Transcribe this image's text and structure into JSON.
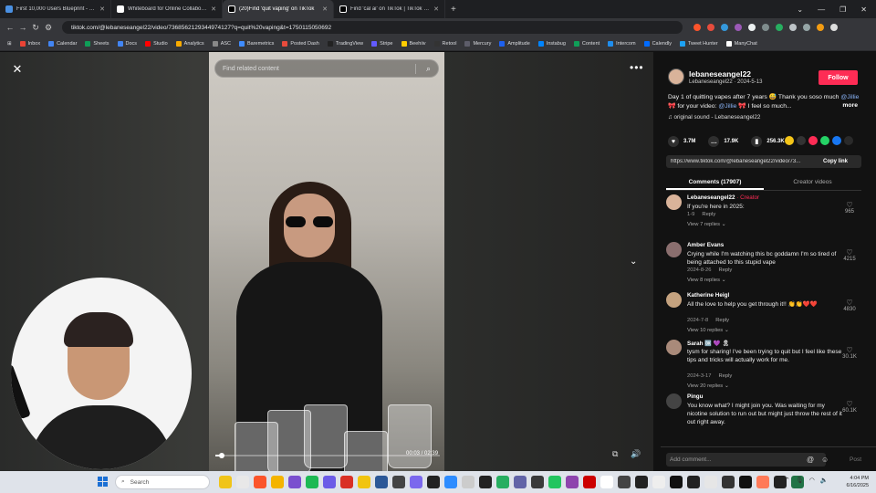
{
  "browser": {
    "tabs": [
      {
        "label": "First 10,000 Users Blueprint - Google",
        "color": "#4a90e2",
        "active": false
      },
      {
        "label": "Whiteboard for Online Collaboration",
        "color": "#ffffff",
        "active": false
      },
      {
        "label": "(20)Find 'quit vaping' on TikTok",
        "color": "#111111",
        "active": true
      },
      {
        "label": "Find 'cal ai' on TikTok | TikTok Search",
        "color": "#111111",
        "active": false
      }
    ],
    "url": "tiktok.com/@lebaneseangel22/video/7368562129344974127?q=quit%20vaping&t=1750115050692",
    "bookmarks": [
      {
        "label": "Inbox",
        "color": "#ea4335"
      },
      {
        "label": "Calendar",
        "color": "#4285f4"
      },
      {
        "label": "Sheets",
        "color": "#0f9d58"
      },
      {
        "label": "Docs",
        "color": "#4285f4"
      },
      {
        "label": "Studio",
        "color": "#ff0000"
      },
      {
        "label": "Analytics",
        "color": "#f9ab00"
      },
      {
        "label": "ASC",
        "color": "#888888"
      },
      {
        "label": "Baremetrics",
        "color": "#3f8cff"
      },
      {
        "label": "Posted Dash",
        "color": "#e84b3c"
      },
      {
        "label": "TradingView",
        "color": "#222222"
      },
      {
        "label": "Stripe",
        "color": "#635bff"
      },
      {
        "label": "Beehiiv",
        "color": "#ffcc00"
      },
      {
        "label": "Retool",
        "color": "#333333"
      },
      {
        "label": "Mercury",
        "color": "#5d5d6a"
      },
      {
        "label": "Amplitude",
        "color": "#1e61f0"
      },
      {
        "label": "Instabug",
        "color": "#0084ff"
      },
      {
        "label": "Content",
        "color": "#0f9d58"
      },
      {
        "label": "Intercom",
        "color": "#1f8ded"
      },
      {
        "label": "Calendly",
        "color": "#006bff"
      },
      {
        "label": "Tweet Hunter",
        "color": "#1da1f2"
      },
      {
        "label": "ManyChat",
        "color": "#ffffff"
      }
    ]
  },
  "video": {
    "search_placeholder": "Find related content",
    "time": "00:03 / 02:39",
    "progress": 0.03
  },
  "post": {
    "author": "lebaneseangel22",
    "author_sub": "Lebaneseangel22 · 2024-5-13",
    "follow_label": "Follow",
    "caption_part1": "Day 1 of quitting vapes after 7 years 😅 Thank you soso much ",
    "caption_mention1": "@Jillie",
    "caption_part2": " 🎀 for your video: ",
    "caption_mention2": "@Jillie",
    "caption_part3": " 🎀 I feel so much...",
    "caption_more": "more",
    "sound": "♫  original sound - Lebaneseangel22",
    "likes": "3.7M",
    "comments": "17.9K",
    "saves": "256.3K",
    "link": "https://www.tiktok.com/@lebaneseangel22/video/73...",
    "copy_link": "Copy link",
    "tab_comments": "Comments (17907)",
    "tab_creator": "Creator videos",
    "share_colors": [
      "#f5c518",
      "#333333",
      "#fe2c55",
      "#25d366",
      "#1877f2",
      "#2a2a2a"
    ]
  },
  "comments": [
    {
      "user": "Lebaneseangel22",
      "creator": "· Creator",
      "text": "If you're here in 2025:",
      "date": "1-9",
      "reply": "Reply",
      "replies": "View 7 replies ⌄",
      "likes": "965",
      "avatar": "#d9b39a"
    },
    {
      "user": "Amber Evans",
      "creator": "",
      "text": "Crying while I'm watching this bc goddamn I'm so tired of being attached to this stupid vape",
      "date": "2024-8-26",
      "reply": "Reply",
      "replies": "View 8 replies ⌄",
      "likes": "4215",
      "avatar": "#8a6e6e"
    },
    {
      "user": "Katherine Heigl",
      "creator": "",
      "text": "All the love to help you get through it!! 👏👏❤️❤️",
      "date": "2024-7-8",
      "reply": "Reply",
      "replies": "View 10 replies ⌄",
      "likes": "4830",
      "avatar": "#c4a27f"
    },
    {
      "user": "Sarah 🆗 💜 🎗",
      "creator": "",
      "text": "tysm for sharing! I've been trying to quit but I feel like these tips and tricks will actually work for me.",
      "date": "2024-3-17",
      "reply": "Reply",
      "replies": "View 20 replies ⌄",
      "likes": "30.1K",
      "avatar": "#a98a7a"
    },
    {
      "user": "Pingu",
      "creator": "",
      "text": "You know what? I might join you. Was waiting for my nicotine solution to run out but might just throw the rest of it out right away.",
      "date": "",
      "reply": "",
      "replies": "",
      "likes": "60.1K",
      "avatar": "#444444"
    }
  ],
  "add_comment": {
    "placeholder": "Add comment...",
    "post": "Post"
  },
  "taskbar": {
    "search": "Search",
    "time": "4:04 PM",
    "date": "6/16/2025",
    "app_colors": [
      "#f0c419",
      "#e8e8e8",
      "#fb542b",
      "#f4b400",
      "#7a4fcf",
      "#1db954",
      "#6c5ce7",
      "#d93025",
      "#f1c40f",
      "#2b5797",
      "#444444",
      "#7b68ee",
      "#222222",
      "#2d8cff",
      "#cccccc",
      "#222222",
      "#27ae60",
      "#6264a7",
      "#3a3a3a",
      "#22c55e",
      "#8e44ad",
      "#cc0000",
      "#ffffff",
      "#444444",
      "#222222",
      "#eeeeee",
      "#111111",
      "#222222",
      "#e6e6e6",
      "#333333",
      "#111111",
      "#ff7a59",
      "#222222",
      "#217346"
    ]
  }
}
